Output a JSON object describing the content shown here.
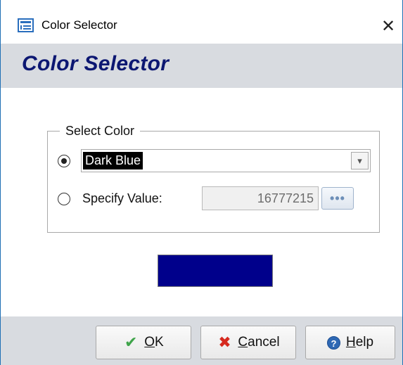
{
  "window": {
    "title": "Color Selector",
    "close_glyph": "✕"
  },
  "header": {
    "title": "Color Selector"
  },
  "select_color": {
    "legend": "Select Color",
    "named_option": {
      "selected": true,
      "value": "Dark Blue",
      "arrow_glyph": "▾"
    },
    "specify_option": {
      "selected": false,
      "label": "Specify Value:",
      "value": "16777215",
      "builder_glyph": "•••"
    }
  },
  "preview": {
    "color": "#00008B"
  },
  "buttons": {
    "ok": {
      "accel": "O",
      "rest": "K",
      "icon": "check-icon",
      "glyph": "✔"
    },
    "cancel": {
      "accel": "C",
      "rest": "ancel",
      "icon": "x-icon",
      "glyph": "✖"
    },
    "help": {
      "accel": "H",
      "rest": "elp",
      "icon": "help-icon",
      "glyph": "?"
    }
  },
  "colors": {
    "header_text": "#0C1772",
    "band": "#D8DBE0",
    "window_border": "#1F6FB5"
  }
}
